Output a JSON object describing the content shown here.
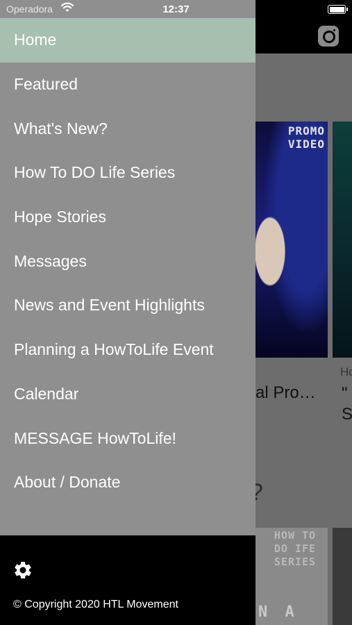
{
  "status_bar": {
    "carrier": "Operadora",
    "time": "12:37"
  },
  "menu": {
    "items": [
      {
        "label": "Home",
        "active": true
      },
      {
        "label": "Featured"
      },
      {
        "label": "What's New?"
      },
      {
        "label": "How To DO Life Series"
      },
      {
        "label": "Hope Stories"
      },
      {
        "label": "Messages"
      },
      {
        "label": "News and Event Highlights"
      },
      {
        "label": "Planning a HowToLife Event"
      },
      {
        "label": "Calendar"
      },
      {
        "label": "MESSAGE HowToLife!"
      },
      {
        "label": "About / Donate"
      }
    ],
    "active_color": "#a7bfae"
  },
  "footer": {
    "copyright": "© Copyright 2020 HTL Movement"
  },
  "background": {
    "card1_badge": "PROMO VIDEO",
    "card1_title": "al Pro…",
    "card2_category": "Ho",
    "card2_title_line1": "\"",
    "card2_title_line2": "S",
    "section_fragment": "?",
    "card3_text": "HOW TO DO IFE SERIES",
    "card3_bottom": "N A"
  }
}
